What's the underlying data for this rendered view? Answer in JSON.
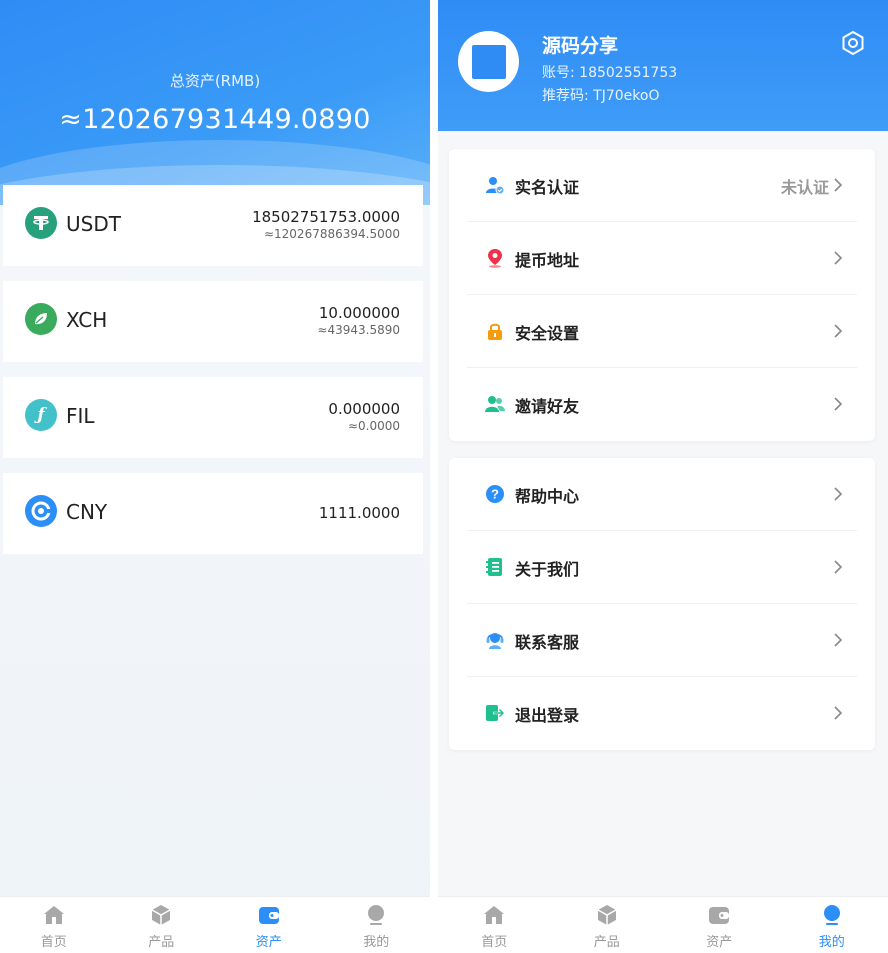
{
  "assets_page": {
    "total_label": "总资产(RMB)",
    "total_value": "≈120267931449.0890",
    "assets": [
      {
        "symbol": "USDT",
        "amount": "18502751753.0000",
        "approx": "≈120267886394.5000",
        "icon": "tether-icon",
        "color": "#26a17b"
      },
      {
        "symbol": "XCH",
        "amount": "10.000000",
        "approx": "≈43943.5890",
        "icon": "chia-leaf-icon",
        "color": "#3aaa5c"
      },
      {
        "symbol": "FIL",
        "amount": "0.000000",
        "approx": "≈0.0000",
        "icon": "filecoin-icon",
        "color": "#42c1ca"
      },
      {
        "symbol": "CNY",
        "amount": "1111.0000",
        "icon": "cny-coin-icon",
        "color": "#2c8ef7"
      }
    ]
  },
  "profile_page": {
    "user_name": "源码分享",
    "account_label": "账号:",
    "account_value": "18502551753",
    "referral_label": "推荐码:",
    "referral_value": "TJ70ekoO",
    "menu_group_1": [
      {
        "label": "实名认证",
        "status": "未认证",
        "icon": "user-verify-icon"
      },
      {
        "label": "提币地址",
        "icon": "location-pin-icon"
      },
      {
        "label": "安全设置",
        "icon": "lock-icon"
      },
      {
        "label": "邀请好友",
        "icon": "invite-friends-icon"
      }
    ],
    "menu_group_2": [
      {
        "label": "帮助中心",
        "icon": "help-icon"
      },
      {
        "label": "关于我们",
        "icon": "about-icon"
      },
      {
        "label": "联系客服",
        "icon": "customer-service-icon"
      },
      {
        "label": "退出登录",
        "icon": "logout-icon"
      }
    ]
  },
  "tabbar": {
    "tabs": [
      "首页",
      "产品",
      "资产",
      "我的"
    ]
  },
  "colors": {
    "primary": "#2c8ef7",
    "tab_inactive": "#999999"
  }
}
